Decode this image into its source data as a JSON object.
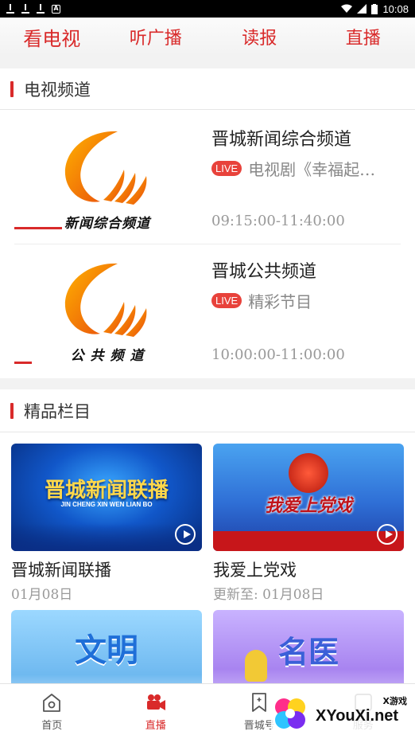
{
  "status_bar": {
    "time": "10:08"
  },
  "top_tabs": [
    {
      "label": "看电视",
      "active": true
    },
    {
      "label": "听广播",
      "active": false
    },
    {
      "label": "读报",
      "active": false
    },
    {
      "label": "直播",
      "active": false
    }
  ],
  "tv_section": {
    "title": "电视频道",
    "channels": [
      {
        "logo_caption": "新闻综合频道",
        "name": "晋城新闻综合频道",
        "live_badge": "LIVE",
        "program": "电视剧《幸福起…",
        "time": "09:15:00-11:40:00"
      },
      {
        "logo_caption": "公 共 频 道",
        "name": "晋城公共频道",
        "live_badge": "LIVE",
        "program": "精彩节目",
        "time": "10:00:00-11:00:00"
      }
    ]
  },
  "featured_section": {
    "title": "精品栏目",
    "programs": [
      {
        "thumb_text": "晋城新闻联播",
        "thumb_subtext": "JIN CHENG XIN WEN LIAN BO",
        "title": "晋城新闻联播",
        "date": "01月08日"
      },
      {
        "thumb_text": "我爱上党戏",
        "title": "我爱上党戏",
        "date": "更新至:   01月08日"
      },
      {
        "thumb_text": "文明"
      },
      {
        "thumb_text": "名医"
      }
    ]
  },
  "bottom_nav": [
    {
      "label": "首页",
      "icon": "home-icon",
      "active": false
    },
    {
      "label": "直播",
      "icon": "video-camera-icon",
      "active": true
    },
    {
      "label": "晋城号",
      "icon": "bookmark-icon",
      "active": false
    },
    {
      "label": "服务",
      "icon": "grid-icon",
      "active": false
    }
  ],
  "watermark": {
    "text": "XYouXi.net",
    "tag": "X游戏"
  },
  "colors": {
    "accent": "#d92a2a",
    "live": "#e8423b"
  }
}
